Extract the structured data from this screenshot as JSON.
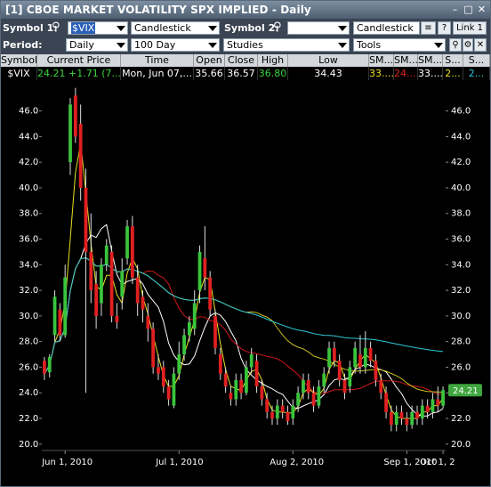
{
  "window": {
    "title": "[1] CBOE MARKET VOLATILITY SPX IMPLIED - Daily"
  },
  "toolbar": {
    "symbol1_label": "Symbol 1:",
    "symbol1_value": "$VIX",
    "chart_type1": "Candlestick",
    "symbol2_label": "Symbol 2:",
    "symbol2_value": "",
    "chart_type2": "Candlestick",
    "link_label": "Link 1",
    "help_label": "?",
    "period_label": "Period:",
    "period_value": "Daily",
    "range_value": "100 Day",
    "studies_value": "Studies",
    "tools_value": "Tools"
  },
  "quote_table": {
    "headers": [
      "Symbol",
      "Current Price",
      "Time",
      "Open",
      "Close",
      "High",
      "Low",
      "SM...",
      "SM...",
      "SM...",
      "S...",
      "S..."
    ],
    "row": [
      "$VIX",
      "24.21",
      "+1.71 (7....",
      "Mon, Jun 07,...",
      "35.66",
      "36.57",
      "36.80",
      "34.43",
      "33....",
      "24....",
      "33....",
      "2...",
      "2..."
    ]
  },
  "colors": {
    "up": "#39c43c",
    "down": "#e02020",
    "sma_short": "#e8e020",
    "sma_mid": "#ffffff",
    "sma_red": "#d01818",
    "sma_long": "#c8c020",
    "sma_cyan": "#30c8d8",
    "price_tag": "#3fa63f"
  },
  "chart_data": {
    "type": "candlestick",
    "ylim": [
      19.5,
      47.5
    ],
    "yticks": [
      "20.0",
      "22.0",
      "24.0",
      "26.0",
      "28.0",
      "30.0",
      "32.0",
      "34.0",
      "36.0",
      "38.0",
      "40.0",
      "42.0",
      "44.0",
      "46.0"
    ],
    "xticks": [
      "Jun 1, 2010",
      "Jul 1, 2010",
      "Aug 2, 2010",
      "Sep 1, 2010",
      "Oct 1, 2"
    ],
    "last_price_tag": "24.21",
    "candles": [
      [
        26.5,
        25.5,
        26.8,
        25.0
      ],
      [
        25.6,
        26.8,
        27.0,
        25.2
      ],
      [
        28.5,
        31.5,
        32.0,
        28.0
      ],
      [
        30.5,
        28.5,
        31.0,
        28.0
      ],
      [
        28.5,
        33.0,
        34.0,
        28.3
      ],
      [
        42.0,
        46.5,
        47.0,
        41.0
      ],
      [
        47.2,
        44.0,
        47.8,
        43.5
      ],
      [
        45.0,
        40.0,
        46.5,
        39.0
      ],
      [
        40.0,
        35.0,
        41.5,
        24.0
      ],
      [
        35.0,
        32.0,
        38.0,
        31.0
      ],
      [
        32.5,
        30.0,
        33.5,
        29.0
      ],
      [
        31.0,
        34.0,
        34.5,
        30.0
      ],
      [
        34.0,
        35.5,
        36.0,
        33.5
      ],
      [
        35.0,
        30.0,
        35.5,
        29.5
      ],
      [
        30.0,
        29.5,
        31.0,
        29.0
      ],
      [
        31.5,
        33.5,
        34.5,
        30.5
      ],
      [
        34.5,
        37.0,
        37.5,
        34.0
      ],
      [
        37.0,
        33.0,
        37.8,
        32.5
      ],
      [
        33.0,
        31.0,
        34.0,
        30.0
      ],
      [
        31.5,
        30.5,
        32.0,
        29.5
      ],
      [
        30.0,
        29.0,
        31.0,
        28.0
      ],
      [
        29.0,
        26.0,
        29.5,
        25.5
      ],
      [
        26.0,
        25.5,
        27.0,
        25.0
      ],
      [
        26.0,
        24.5,
        26.5,
        24.0
      ],
      [
        24.5,
        23.5,
        25.0,
        23.0
      ],
      [
        23.0,
        25.5,
        26.0,
        22.8
      ],
      [
        25.5,
        27.0,
        28.0,
        25.0
      ],
      [
        27.0,
        28.5,
        29.0,
        26.5
      ],
      [
        28.5,
        29.5,
        30.0,
        28.0
      ],
      [
        29.0,
        31.0,
        32.0,
        28.5
      ],
      [
        32.0,
        35.0,
        35.5,
        31.0
      ],
      [
        34.5,
        33.0,
        37.0,
        32.0
      ],
      [
        33.0,
        30.5,
        33.5,
        30.0
      ],
      [
        30.0,
        27.5,
        30.5,
        27.0
      ],
      [
        27.0,
        25.5,
        27.5,
        25.0
      ],
      [
        25.5,
        24.5,
        26.0,
        24.0
      ],
      [
        24.0,
        23.5,
        24.5,
        23.0
      ],
      [
        23.5,
        25.0,
        25.5,
        23.0
      ],
      [
        25.0,
        24.0,
        25.5,
        23.5
      ],
      [
        24.0,
        26.0,
        26.5,
        23.8
      ],
      [
        26.0,
        27.0,
        27.5,
        25.5
      ],
      [
        26.5,
        24.5,
        27.0,
        24.0
      ],
      [
        24.5,
        23.5,
        25.0,
        23.0
      ],
      [
        23.5,
        22.5,
        24.0,
        22.0
      ],
      [
        22.5,
        22.0,
        23.0,
        21.5
      ],
      [
        22.0,
        23.0,
        23.5,
        21.5
      ],
      [
        23.0,
        22.5,
        23.5,
        22.0
      ],
      [
        22.5,
        21.8,
        23.0,
        21.5
      ],
      [
        22.0,
        23.0,
        23.5,
        21.5
      ],
      [
        23.0,
        24.0,
        24.5,
        22.5
      ],
      [
        24.0,
        25.0,
        25.5,
        23.5
      ],
      [
        25.0,
        24.0,
        25.5,
        23.5
      ],
      [
        24.0,
        23.0,
        24.5,
        22.5
      ],
      [
        23.0,
        24.5,
        25.0,
        22.8
      ],
      [
        24.5,
        25.5,
        26.0,
        24.0
      ],
      [
        26.0,
        27.5,
        28.0,
        25.5
      ],
      [
        27.5,
        26.5,
        28.0,
        26.0
      ],
      [
        26.5,
        25.0,
        27.0,
        24.5
      ],
      [
        25.0,
        24.0,
        25.5,
        23.5
      ],
      [
        24.5,
        26.0,
        26.5,
        24.0
      ],
      [
        26.0,
        27.5,
        28.0,
        25.5
      ],
      [
        27.0,
        26.0,
        28.5,
        25.5
      ],
      [
        26.0,
        27.5,
        28.8,
        25.5
      ],
      [
        27.5,
        26.5,
        28.0,
        26.0
      ],
      [
        26.5,
        25.0,
        27.0,
        24.5
      ],
      [
        25.0,
        24.0,
        25.5,
        23.5
      ],
      [
        24.0,
        22.5,
        24.5,
        22.0
      ],
      [
        22.5,
        21.5,
        23.0,
        21.0
      ],
      [
        21.5,
        22.5,
        23.0,
        21.0
      ],
      [
        22.5,
        22.0,
        23.0,
        21.5
      ],
      [
        22.0,
        21.5,
        22.5,
        21.0
      ],
      [
        21.5,
        22.5,
        23.0,
        21.2
      ],
      [
        22.5,
        22.0,
        23.0,
        21.5
      ],
      [
        22.0,
        23.0,
        23.5,
        21.5
      ],
      [
        23.0,
        22.5,
        23.5,
        22.0
      ],
      [
        22.5,
        23.5,
        24.0,
        22.0
      ],
      [
        23.5,
        23.0,
        24.5,
        22.5
      ],
      [
        23.0,
        24.21,
        24.5,
        22.8
      ]
    ]
  }
}
